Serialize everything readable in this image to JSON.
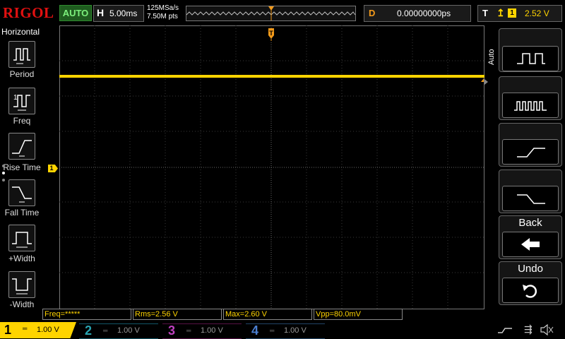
{
  "header": {
    "brand": "RIGOL",
    "run_state": "AUTO",
    "timebase_label": "H",
    "timebase_value": "5.00ms",
    "sample_rate": "125MSa/s",
    "memory_depth": "7.50M pts",
    "delay_label": "D",
    "delay_value": "0.00000000ps",
    "trigger_label": "T",
    "trigger_source": "1",
    "trigger_level": "2.52 V"
  },
  "left_menu": {
    "title": "Horizontal",
    "items": [
      {
        "label": "Period",
        "icon": "period-icon"
      },
      {
        "label": "Freq",
        "icon": "freq-icon"
      },
      {
        "label": "Rise Time",
        "icon": "rise-time-icon"
      },
      {
        "label": "Fall Time",
        "icon": "fall-time-icon"
      },
      {
        "label": "+Width",
        "icon": "positive-width-icon"
      },
      {
        "label": "-Width",
        "icon": "negative-width-icon"
      }
    ]
  },
  "right_menu": {
    "mode_label": "Auto",
    "buttons": [
      {
        "icon": "single-pulse-icon"
      },
      {
        "icon": "pulse-train-icon"
      },
      {
        "icon": "rising-edge-icon"
      },
      {
        "icon": "falling-edge-icon"
      },
      {
        "label": "Back",
        "icon": "back-arrow-icon"
      },
      {
        "label": "Undo",
        "icon": "undo-icon"
      }
    ]
  },
  "channel_marker": "1",
  "trigger_position_marker": "T",
  "measurements": [
    {
      "text": "Freq=*****"
    },
    {
      "text": "Rms=2.56 V"
    },
    {
      "text": "Max=2.60 V"
    },
    {
      "text": "Vpp=80.0mV"
    }
  ],
  "channels": [
    {
      "number": "1",
      "scale": "1.00 V",
      "color": "#ffd400",
      "active": true
    },
    {
      "number": "2",
      "scale": "1.00 V",
      "color": "#2aa6b3",
      "active": false
    },
    {
      "number": "3",
      "scale": "1.00 V",
      "color": "#c040c0",
      "active": false
    },
    {
      "number": "4",
      "scale": "1.00 V",
      "color": "#4a7fd0",
      "active": false
    }
  ],
  "colors": {
    "trace": "#ffd400",
    "trigger": "#f39a1a",
    "brand": "#e01010"
  }
}
